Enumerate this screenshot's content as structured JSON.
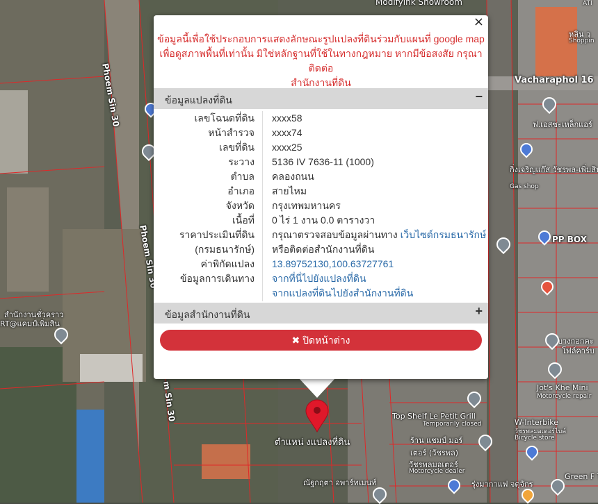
{
  "map": {
    "road_labels": {
      "phoem_sin_30_top": "Phoem Sin 30",
      "phoem_sin_30_mid": "Phoem Sin 30",
      "phoem_sin_30_bottom": "m Sin 30",
      "vacharaphol_16": "Vacharaphol 16",
      "modify_showroom": "Modifyink Showroom"
    },
    "poi_labels": {
      "gas_station_th": "กิ่งเจริญแก๊ส วัชรพล-เพิ่มสิน",
      "gas_shop": "Gas shop",
      "pp_box": "PP BOX",
      "fs_shop": "ฟ.เอสซะเหล็กแอร์",
      "top_shelf": "Top Shelf Le Petit Grill",
      "temporarily_closed": "Temporarily closed",
      "ran_shop": "ร้าน แชมป์ มอร์ เตอร์ (วัชรพล)",
      "watcharapol_motor": "วัชรพลมอเตอร์",
      "motorcycle_dealer": "Motorcycle dealer",
      "jots_khe": "Jot's Khe Mini",
      "motorcycle_repair": "Motorcycle repair",
      "w_interbike": "W-Interbike",
      "bicycle_store": "Bicycle store",
      "w_interbike_th": "วัชรพลมอเตอร์ไบค์",
      "green_trading": "Green F Tradin",
      "nuttharika": "ณัฐกฤตา อพาร์ทเมนท์",
      "rung_cafe": "รุ่งมากาแฟ จตุจักร",
      "office_left": "สำนักงานชั่วคราว",
      "office_left2": "RT@แคมป์เพิ่มสิน",
      "lan_shop": "หลิน ว",
      "shopping": "Shoppin",
      "bangkok_right": "บางกอกคะ",
      "bangkok_right2": "โฟล์คาร์บ",
      "ati": "ATI"
    },
    "location_label": "ตำแหน่ งแปลงที่ดิน"
  },
  "popup": {
    "close_symbol": "×",
    "disclaimer_lines": [
      "ข้อมูลนี้เพื่อใช้ประกอบการแสดงลักษณะรูปแปลงที่ดินร่วมกับแผนที่ google map",
      "เพื่อดูสภาพพื้นที่เท่านั้น มิใช่หลักฐานที่ใช้ในทางกฎหมาย หากมีข้อสงสัย กรุณาติดต่อ",
      "สำนักงานที่ดิน"
    ],
    "land_section": {
      "title": "ข้อมูลแปลงที่ดิน",
      "toggle": "−"
    },
    "rows": [
      {
        "label": "เลขโฉนดที่ดิน",
        "value": "xxxx58"
      },
      {
        "label": "หน้าสำรวจ",
        "value": "xxxx74"
      },
      {
        "label": "เลขที่ดิน",
        "value": "xxxx25"
      },
      {
        "label": "ระวาง",
        "value": "5136 IV 7636-11 (1000)"
      },
      {
        "label": "ตำบล",
        "value": "คลองถนน"
      },
      {
        "label": "อำเภอ",
        "value": "สายไหม"
      },
      {
        "label": "จังหวัด",
        "value": "กรุงเทพมหานคร"
      },
      {
        "label": "เนื้อที่",
        "value": "0 ไร่ 1 งาน 0.0 ตารางวา"
      }
    ],
    "price": {
      "label1": "ราคาประเมินที่ดิน",
      "label2": "(กรมธนารักษ์)",
      "text1": "กรุณาตรวจสอบข้อมูลผ่านทาง",
      "link1": "เว็บไซต์กรมธนารักษ์",
      "text2": "หรือติดต่อสำนักงานที่ดิน"
    },
    "coords": {
      "label": "ค่าพิกัดแปลง",
      "value": "13.89752130,100.63727761"
    },
    "travel": {
      "label": "ข้อมูลการเดินทาง",
      "link1": "จากที่นี่ไปยังแปลงที่ดิน",
      "link2": "จากแปลงที่ดินไปยังสำนักงานที่ดิน"
    },
    "office_section": {
      "title": "ข้อมูลสำนักงานที่ดิน",
      "toggle": "+"
    },
    "close_button": {
      "icon": "✖",
      "label": "ปิดหน้าต่าง"
    }
  }
}
